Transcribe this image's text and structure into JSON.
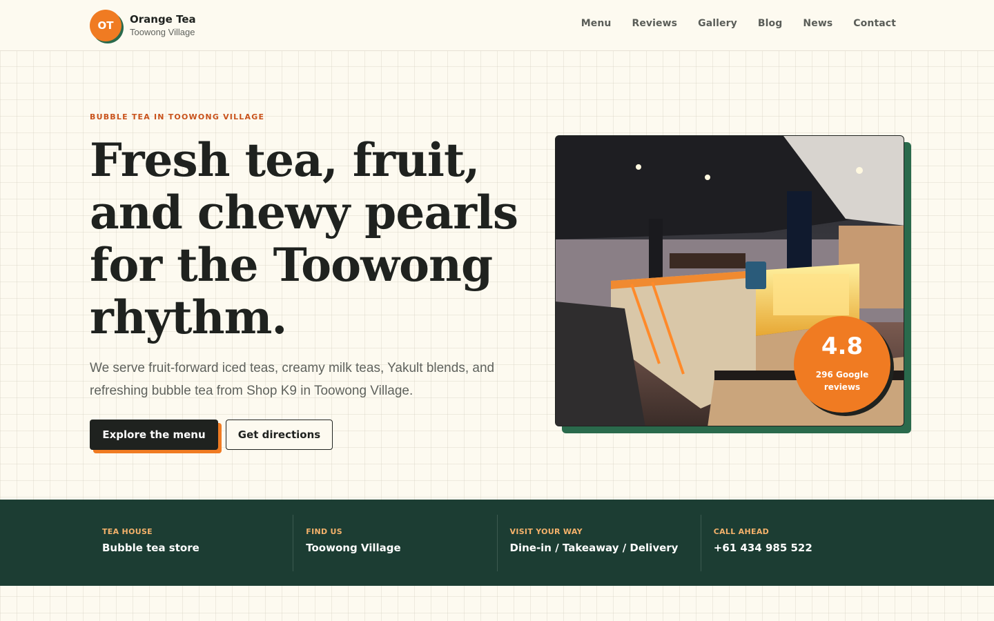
{
  "brand": {
    "logo_text": "OT",
    "name": "Orange Tea",
    "location": "Toowong Village"
  },
  "nav": {
    "items": [
      "Menu",
      "Reviews",
      "Gallery",
      "Blog",
      "News",
      "Contact"
    ]
  },
  "hero": {
    "eyebrow": "BUBBLE TEA IN TOOWONG VILLAGE",
    "headline": "Fresh tea, fruit, and chewy pearls for the Toowong rhythm.",
    "lead": "We serve fruit-forward iced teas, creamy milk teas, Yakult blends, and refreshing bubble tea from Shop K9 in Toowong Village.",
    "primary_cta": "Explore the menu",
    "secondary_cta": "Get directions"
  },
  "rating": {
    "score": "4.8",
    "label": "296 Google reviews"
  },
  "info": [
    {
      "label": "TEA HOUSE",
      "value": "Bubble tea store"
    },
    {
      "label": "FIND US",
      "value": "Toowong Village"
    },
    {
      "label": "VISIT YOUR WAY",
      "value": "Dine-in / Takeaway / Delivery"
    },
    {
      "label": "CALL AHEAD",
      "value": "+61 434 985 522"
    }
  ],
  "colors": {
    "accent_orange": "#f07b22",
    "dark_green": "#1c3d33",
    "shadow_green": "#2a6a4c",
    "ink": "#1f221f",
    "background": "#fdfaf0"
  }
}
